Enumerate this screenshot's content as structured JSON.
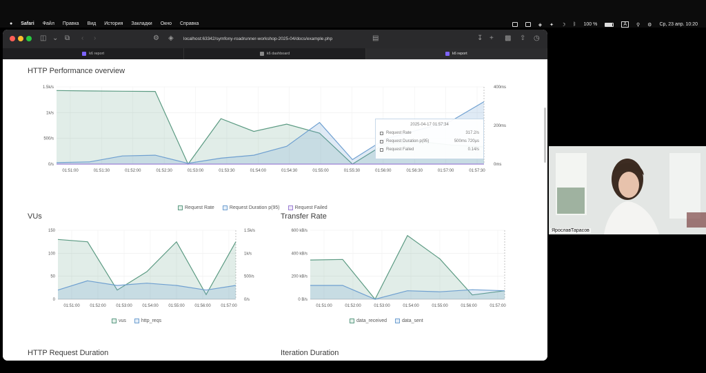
{
  "menubar": {
    "apple": "",
    "items": [
      "Safari",
      "Файл",
      "Правка",
      "Вид",
      "История",
      "Закладки",
      "Окно",
      "Справка"
    ],
    "battery": "100 %",
    "input_source": "A",
    "datetime": "Ср, 23 апр.  10:20"
  },
  "browser": {
    "url": "localhost:63342/symfony-roadrunner-workshop-2025-04/docs/example.php",
    "tabs": [
      {
        "label": "k6 report",
        "active": false
      },
      {
        "label": "k6 dashboard",
        "active": false
      },
      {
        "label": "k6 report",
        "active": true
      }
    ]
  },
  "sections": {
    "http_perf": "HTTP Performance overview",
    "vus": "VUs",
    "transfer": "Transfer Rate",
    "req_duration": "HTTP Request Duration",
    "iteration": "Iteration Duration"
  },
  "tooltip": {
    "time": "2025-04-17 01:57:34",
    "rows": [
      {
        "label": "Request Rate",
        "value": "317.2/s"
      },
      {
        "label": "Request Duration p(95)",
        "value": "500ms 720µs"
      },
      {
        "label": "Request Failed",
        "value": "0.14/s"
      }
    ]
  },
  "chart_data": [
    {
      "type": "area",
      "title": "HTTP Performance overview",
      "x": [
        "01:51:00",
        "01:51:30",
        "01:52:00",
        "01:52:30",
        "01:53:00",
        "01:53:30",
        "01:54:00",
        "01:54:30",
        "01:55:00",
        "01:55:30",
        "01:56:00",
        "01:56:30",
        "01:57:00",
        "01:57:30"
      ],
      "y_left_ticks": [
        "0/s",
        "500/s",
        "1k/s",
        "1.5k/s"
      ],
      "y_right_ticks": [
        "0ms",
        "200ms",
        "400ms"
      ],
      "series": [
        {
          "name": "Request Rate",
          "color": "#5b9a82",
          "values": [
            1620,
            1610,
            1605,
            1600,
            0,
            1000,
            720,
            880,
            680,
            0,
            450,
            500,
            420,
            380
          ]
        },
        {
          "name": "Request Duration p(95)",
          "color": "#6e9fd0",
          "values": [
            10,
            15,
            55,
            60,
            5,
            40,
            60,
            120,
            280,
            30,
            170,
            230,
            290,
            420
          ]
        },
        {
          "name": "Request Failed",
          "color": "#9b7fd4",
          "values": [
            0,
            0,
            0,
            0,
            0,
            0,
            0,
            0,
            0,
            0,
            0,
            0,
            0,
            0
          ]
        }
      ],
      "legend_position": "bottom"
    },
    {
      "type": "area",
      "title": "VUs",
      "x": [
        "01:51:00",
        "01:52:00",
        "01:53:00",
        "01:54:00",
        "01:55:00",
        "01:56:00",
        "01:57:00"
      ],
      "y_left_ticks": [
        "0",
        "50",
        "100",
        "150"
      ],
      "y_right_ticks": [
        "0/s",
        "500/s",
        "1k/s",
        "1.5k/s"
      ],
      "series": [
        {
          "name": "vus",
          "color": "#5b9a82",
          "values": [
            130,
            125,
            20,
            60,
            125,
            10,
            125
          ]
        },
        {
          "name": "http_reqs",
          "color": "#6e9fd0",
          "values": [
            20,
            40,
            30,
            35,
            30,
            20,
            30
          ]
        }
      ],
      "legend_position": "bottom"
    },
    {
      "type": "area",
      "title": "Transfer Rate",
      "x": [
        "01:51:00",
        "01:52:00",
        "01:53:00",
        "01:54:00",
        "01:55:00",
        "01:56:00",
        "01:57:00"
      ],
      "y_left_ticks": [
        "0 B/s",
        "200 kB/s",
        "400 kB/s",
        "600 kB/s"
      ],
      "series": [
        {
          "name": "data_received",
          "color": "#5b9a82",
          "values": [
            370,
            375,
            0,
            600,
            380,
            40,
            80
          ]
        },
        {
          "name": "data_sent",
          "color": "#6e9fd0",
          "values": [
            130,
            130,
            0,
            80,
            70,
            90,
            80
          ]
        }
      ],
      "legend_position": "bottom"
    }
  ],
  "webcam": {
    "name": "ЯрославТарасов"
  }
}
